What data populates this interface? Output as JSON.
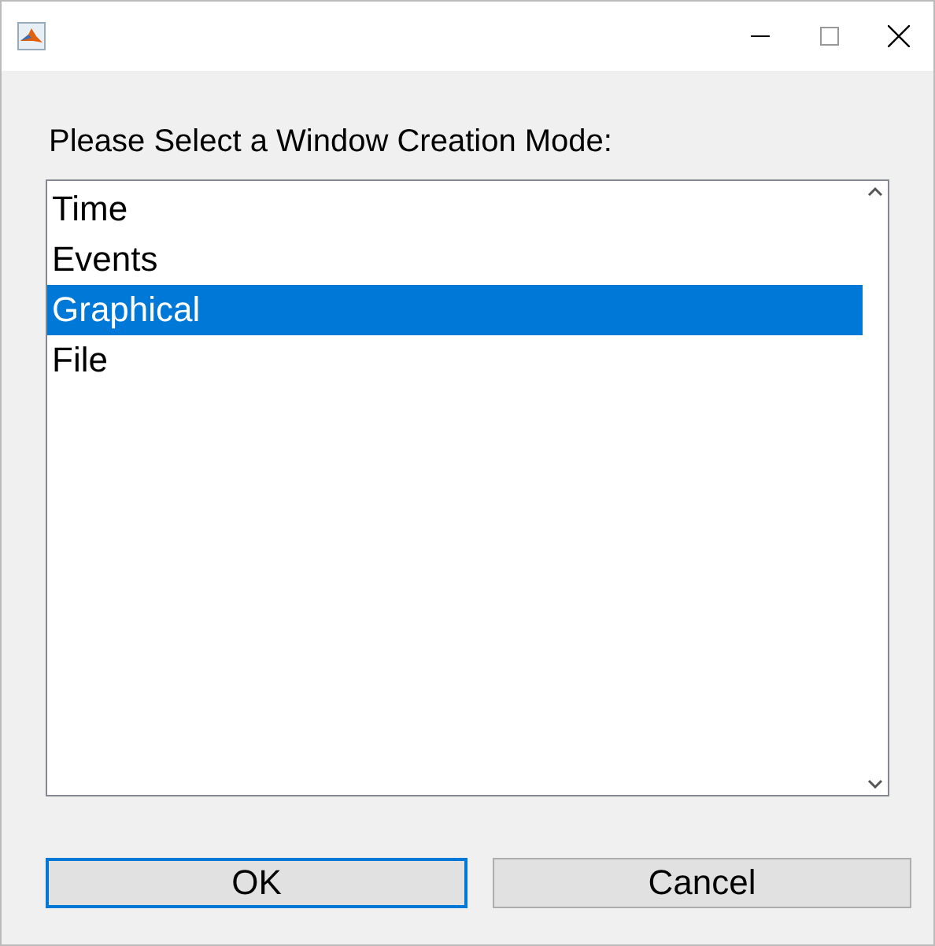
{
  "prompt": "Please Select a Window Creation Mode:",
  "list": [
    {
      "label": "Time",
      "selected": false
    },
    {
      "label": "Events",
      "selected": false
    },
    {
      "label": "Graphical",
      "selected": true
    },
    {
      "label": "File",
      "selected": false
    }
  ],
  "buttons": [
    {
      "label": "OK",
      "kind": "default"
    },
    {
      "label": "Cancel",
      "kind": "normal"
    }
  ]
}
